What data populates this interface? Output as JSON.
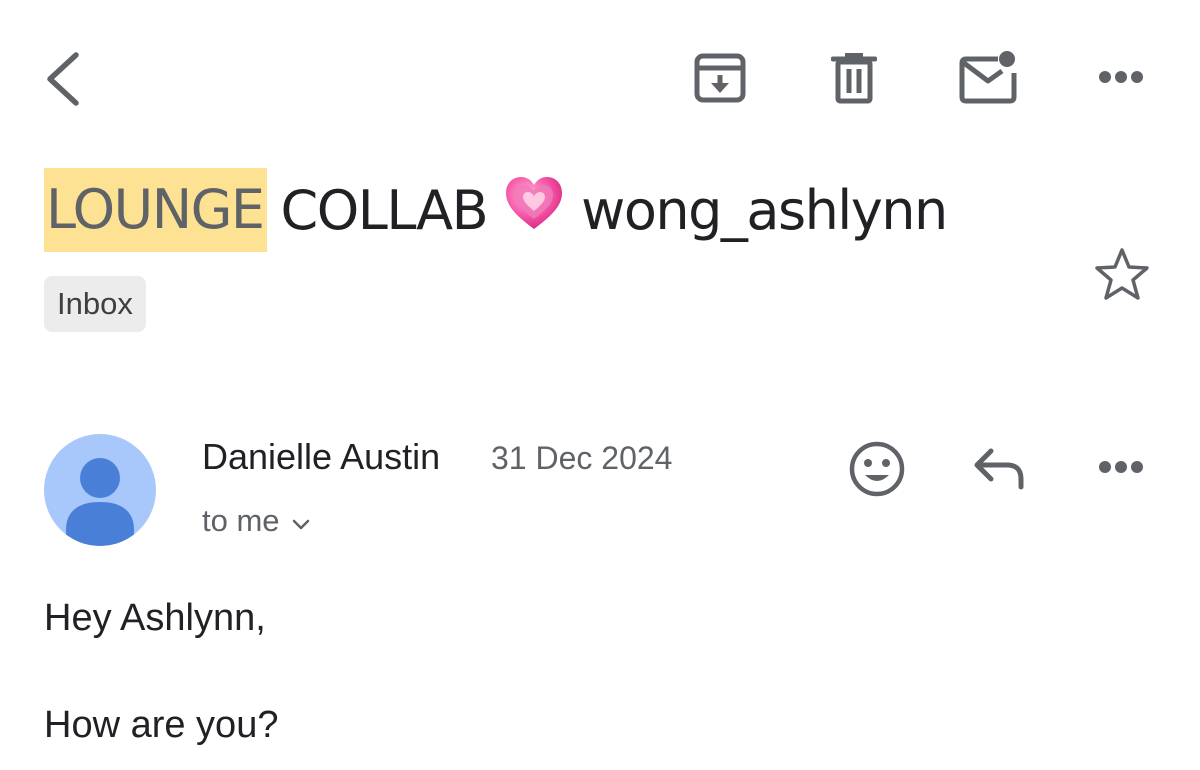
{
  "toolbar": {
    "back_icon": "back-arrow-icon",
    "archive_icon": "archive-icon",
    "delete_icon": "trash-icon",
    "mark_unread_icon": "mail-unread-icon",
    "more_icon": "more-horizontal-icon"
  },
  "subject": {
    "highlighted": "LOUNGE",
    "text_before_emoji": "COLLAB",
    "emoji": "sparkling-heart-icon",
    "text_after_emoji": "wong_ashlynn",
    "highlight_color": "#fde293"
  },
  "labels": [
    "Inbox"
  ],
  "star_icon": "star-outline-icon",
  "message": {
    "sender_name": "Danielle Austin",
    "date": "31 Dec 2024",
    "recipient": "to me",
    "avatar_icon": "person-avatar-icon",
    "avatar_color": "#a8c7fa",
    "actions": {
      "emoji_icon": "emoji-reaction-icon",
      "reply_icon": "reply-icon",
      "more_icon": "more-horizontal-icon"
    },
    "body": [
      "Hey Ashlynn,",
      "How are you?"
    ]
  }
}
